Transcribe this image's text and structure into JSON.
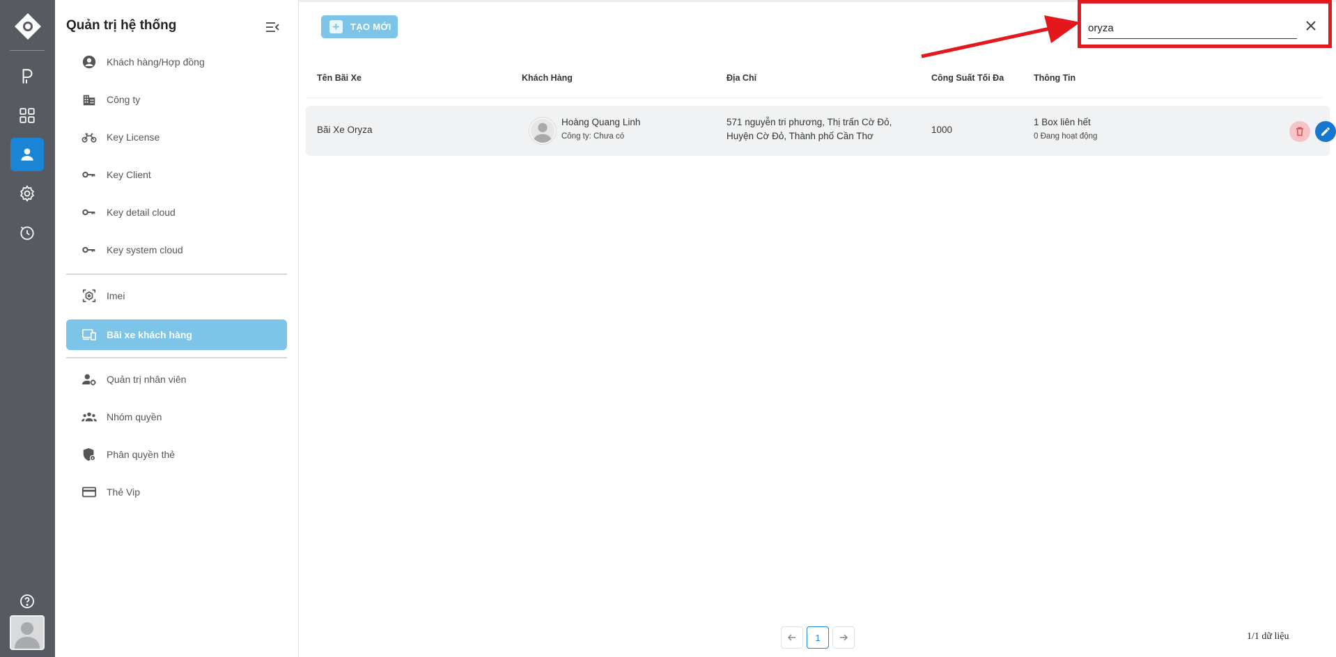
{
  "sidebar": {
    "title": "Quản trị hệ thống",
    "items": [
      {
        "label": "Khách hàng/Hợp đồng",
        "icon": "user-circle-icon"
      },
      {
        "label": "Công ty",
        "icon": "building-icon"
      },
      {
        "label": "Key License",
        "icon": "motorbike-icon"
      },
      {
        "label": "Key Client",
        "icon": "key-icon"
      },
      {
        "label": "Key detail cloud",
        "icon": "key-icon"
      },
      {
        "label": "Key system cloud",
        "icon": "key-icon"
      },
      {
        "label": "Imei",
        "icon": "imei-scan-icon"
      },
      {
        "label": "Bãi xe khách hàng",
        "icon": "devices-icon"
      },
      {
        "label": "Quản trị nhân viên",
        "icon": "user-gear-icon"
      },
      {
        "label": "Nhóm quyền",
        "icon": "group-icon"
      },
      {
        "label": "Phân quyền thẻ",
        "icon": "shield-lock-icon"
      },
      {
        "label": "Thẻ Vip",
        "icon": "card-icon"
      }
    ],
    "active_item": "Bãi xe khách hàng"
  },
  "toolbar": {
    "create_label": "TẠO MỚI",
    "search_value": "oryza"
  },
  "table": {
    "headers": [
      "Tên Bãi Xe",
      "Khách Hàng",
      "Địa Chỉ",
      "Công Suất Tối Đa",
      "Thông Tin"
    ],
    "rows": [
      {
        "name": "Bãi Xe Oryza",
        "customer_name": "Hoàng Quang Linh",
        "customer_company": "Công ty: Chưa có",
        "address_line1": "571 nguyễn tri phương, Thị trấn Cờ Đỏ,",
        "address_line2": "Huyện Cờ Đỏ, Thành phố Cần Thơ",
        "capacity": "1000",
        "info_line1": "1 Box liên hết",
        "info_line2": "0 Đang hoạt động"
      }
    ]
  },
  "pagination": {
    "current_page": "1",
    "summary": "1/1 dữ liệu"
  },
  "colors": {
    "rail_bg": "#575b61",
    "accent": "#1a85d6",
    "active_nav": "#7cc4e8",
    "annotation_red": "#e3181d",
    "delete_bg": "#f6c3c6",
    "edit_bg": "#1777cc",
    "more_bg": "#ef6d15"
  }
}
